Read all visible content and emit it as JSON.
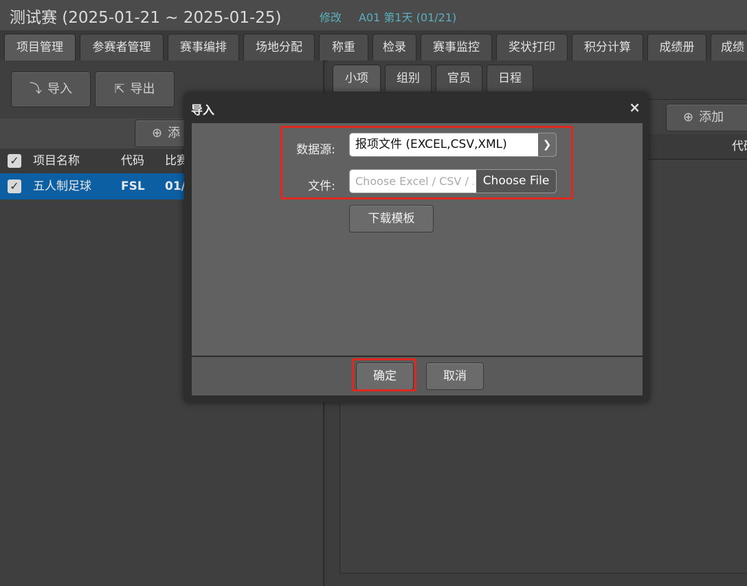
{
  "header": {
    "title": "测试赛 (2025-01-21 ~ 2025-01-25)",
    "edit_label": "修改",
    "status": "A01 第1天 (01/21)"
  },
  "main_tabs": [
    {
      "label": "项目管理",
      "active": true
    },
    {
      "label": "参赛者管理"
    },
    {
      "label": "赛事编排"
    },
    {
      "label": "场地分配"
    },
    {
      "label": "称重"
    },
    {
      "label": "检录"
    },
    {
      "label": "赛事监控"
    },
    {
      "label": "奖状打印"
    },
    {
      "label": "积分计算"
    },
    {
      "label": "成绩册"
    },
    {
      "label": "成绩"
    }
  ],
  "left": {
    "import_label": "导入",
    "export_label": "导出",
    "add_label": "添",
    "columns": [
      "项目名称",
      "代码",
      "比赛"
    ],
    "rows": [
      {
        "name": "五人制足球",
        "code": "FSL",
        "date": "01/"
      }
    ]
  },
  "right": {
    "subtabs": [
      {
        "label": "小项",
        "active": true
      },
      {
        "label": "组别"
      },
      {
        "label": "官员"
      },
      {
        "label": "日程"
      }
    ],
    "add_label": "添加",
    "col_code": "代码"
  },
  "dialog": {
    "title": "导入",
    "close": "×",
    "source_label": "数据源:",
    "source_value": "报项文件 (EXCEL,CSV,XML)",
    "file_label": "文件:",
    "file_placeholder": "Choose Excel / CSV / XML",
    "file_button": "Choose File",
    "template_button": "下载模板",
    "ok_button": "确定",
    "cancel_button": "取消"
  },
  "colors": {
    "highlight": "#e0281e",
    "row_selected": "#0d5fa3",
    "link": "#5ab0c0"
  }
}
